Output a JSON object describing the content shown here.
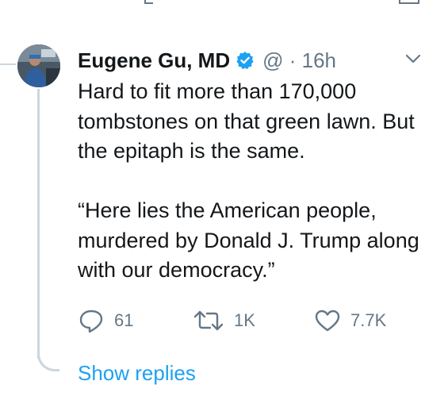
{
  "colors": {
    "text": "#14171a",
    "secondary": "#657786",
    "accent": "#1da1f2",
    "thread_line": "#ccd6dd"
  },
  "tweet": {
    "author_name": "Eugene Gu, MD",
    "handle_time": "@ · 16h",
    "verified_icon": "verified-badge-icon",
    "paragraphs": [
      "Hard to fit more than 170,000 tombstones on that green lawn. But the epitaph is the same.",
      "“Here lies the American people, murdered by Donald J. Trump along with our democracy.”"
    ],
    "actions": {
      "replies": {
        "icon": "reply-icon",
        "count": "61"
      },
      "retweets": {
        "icon": "retweet-icon",
        "count": "1K"
      },
      "likes": {
        "icon": "heart-icon",
        "count": "7.7K"
      }
    }
  },
  "thread": {
    "show_replies_label": "Show replies"
  }
}
